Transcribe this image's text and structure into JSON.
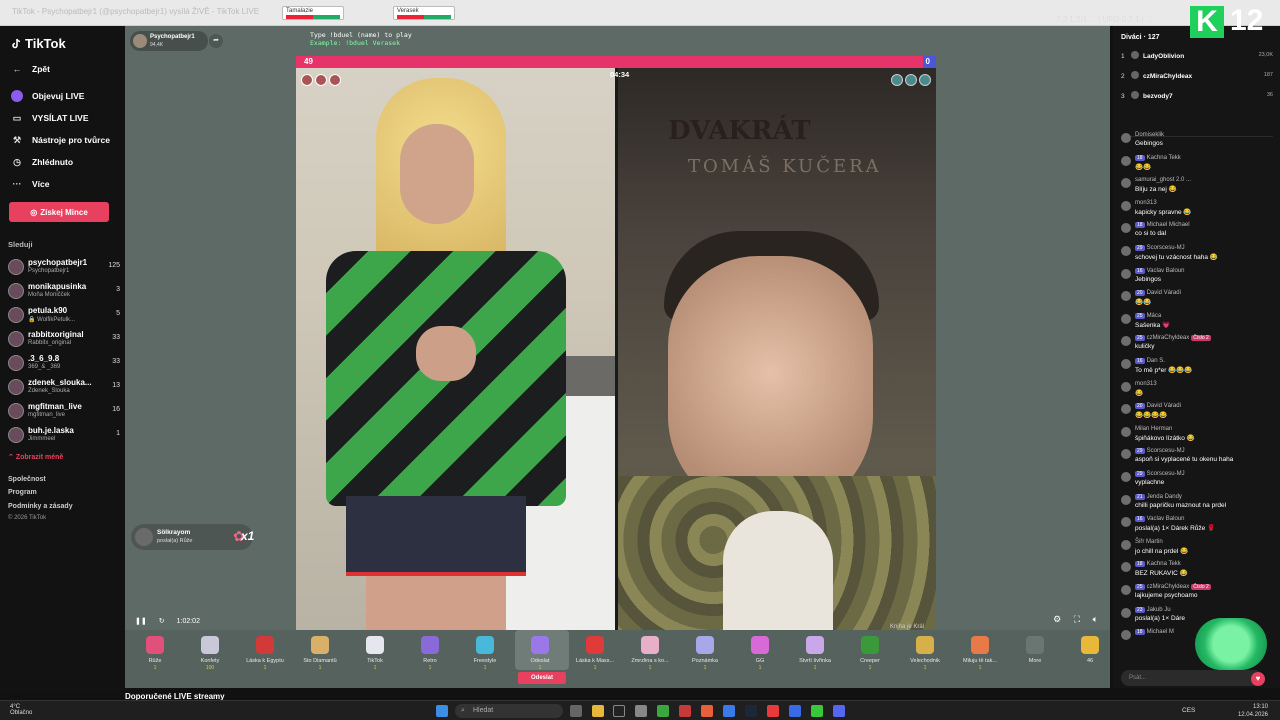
{
  "browser": {
    "tab_text": "TikTok - Psychopatbejr1 (@psychopatbejr1) vysílá ŽIVĚ - TikTok LIVE",
    "mini_tab_left": "Tamalazie",
    "mini_tab_right": "Verasek"
  },
  "sidebar": {
    "logo": "TikTok",
    "nav": [
      {
        "label": "Zpět",
        "icon": "back-arrow-icon"
      },
      {
        "label": "Objevuj LIVE",
        "icon": "live-icon"
      },
      {
        "label": "VYSÍLAT LIVE",
        "icon": "video-icon"
      },
      {
        "label": "Nástroje pro tvůrce",
        "icon": "tools-icon"
      },
      {
        "label": "Zhlédnuto",
        "icon": "history-icon"
      },
      {
        "label": "Více",
        "icon": "more-icon"
      }
    ],
    "coins_button": "Získej Mince",
    "following_title": "Sleduji",
    "following": [
      {
        "name": "psychopatbejr1",
        "sub": "Psychopatbejr1",
        "count": "125"
      },
      {
        "name": "monikapusinka",
        "sub": "Moňa Moničček",
        "count": "3"
      },
      {
        "name": "petula.k90",
        "sub": "🔒 WolfikPetulk...",
        "count": "5"
      },
      {
        "name": "rabbitxoriginal",
        "sub": "Rabbitx_original",
        "count": "33"
      },
      {
        "name": ".3_6_9.8",
        "sub": "369_& _369",
        "count": "33"
      },
      {
        "name": "zdenek_slouka...",
        "sub": "Zdenek_Slouka",
        "count": "13"
      },
      {
        "name": "mgfitman_live",
        "sub": "mgfitman_live",
        "count": "16"
      },
      {
        "name": "buh.je.laska",
        "sub": "Jimmmeel",
        "count": "1"
      }
    ],
    "show_less": "Zobrazit méně",
    "footer_links": [
      "Společnost",
      "Program",
      "Podmínky a zásady"
    ],
    "copyright": "© 2026 TikTok"
  },
  "stream": {
    "host_name": "Psychopatbejr1",
    "host_likes": "94,4K",
    "overlay_type": "Type !bduel (name) to play",
    "overlay_example": "Example: !bduel Verasek",
    "left_score": "49",
    "right_score": "0",
    "left_ratio": 0.98,
    "timer": "04:34",
    "wall_logo": "DVAKRÁT",
    "wall_text": "TOMÁŠ KUČERA",
    "right_caption": "Kniha je Král",
    "gift_popup": {
      "name": "Sölkrayom",
      "action": "poslal(a) Růže",
      "multiplier": "x1"
    },
    "playback_time": "1:02:02",
    "recommended": "Doporučené LIVE streamy"
  },
  "gifts": [
    {
      "name": "Růže",
      "price": "1",
      "color": "#e0507a"
    },
    {
      "name": "Konfety",
      "price": "100",
      "color": "#c8c8d8"
    },
    {
      "name": "Láska k Egyptu",
      "price": "1",
      "color": "#d23a3a"
    },
    {
      "name": "Sto Diamantů",
      "price": "1",
      "color": "#d8b06a"
    },
    {
      "name": "TikTok",
      "price": "1",
      "color": "#e6e6ee"
    },
    {
      "name": "Retro",
      "price": "1",
      "color": "#8a6ad8"
    },
    {
      "name": "Freestyle",
      "price": "1",
      "color": "#4ab8d8"
    },
    {
      "name": "Odeslat",
      "price": "1",
      "color": "#9a78e8"
    },
    {
      "name": "Láska k Mass...",
      "price": "1",
      "color": "#e03a3a"
    },
    {
      "name": "Zmrzlina s ko...",
      "price": "1",
      "color": "#e8b0c8"
    },
    {
      "name": "Poznámka",
      "price": "1",
      "color": "#a8a8e8"
    },
    {
      "name": "GG",
      "price": "1",
      "color": "#d86ad8"
    },
    {
      "name": "Stvrtí švřinka",
      "price": "1",
      "color": "#c8a8e8"
    },
    {
      "name": "Creeper",
      "price": "1",
      "color": "#3a9a3a"
    },
    {
      "name": "Velechodnik",
      "price": "1",
      "color": "#d8b04a"
    },
    {
      "name": "Miluju tě tak...",
      "price": "1",
      "color": "#e87a4a"
    },
    {
      "name": "More",
      "price": "",
      "color": "#6a7672"
    },
    {
      "name": "46",
      "price": "",
      "color": "#e8b83a"
    }
  ],
  "send_label": "Odeslat",
  "chat": {
    "viewers_title": "Diváci · 127",
    "top_viewers": [
      {
        "rank": "1",
        "name": "LadyOblivion",
        "score": "23,0K"
      },
      {
        "rank": "2",
        "name": "czMiraChyldeax",
        "score": "187"
      },
      {
        "rank": "3",
        "name": "bezvody7",
        "score": "36"
      }
    ],
    "messages": [
      {
        "user": "Domiseklik",
        "badge": "",
        "text": "Gebingos",
        "extra": ""
      },
      {
        "user": "Kachna Tekk",
        "badge": "18",
        "text": "😂😂",
        "extra": ""
      },
      {
        "user": "samurai_ghost 2.0 ...",
        "badge": "",
        "text": "Blíju za nej 😂",
        "extra": ""
      },
      {
        "user": "mon313",
        "badge": "",
        "text": "kapicky spravne 😂",
        "extra": ""
      },
      {
        "user": "Michael Michael",
        "badge": "18",
        "text": "co si to dal",
        "extra": ""
      },
      {
        "user": "Scorscesu-MJ",
        "badge": "29",
        "text": "schovej tu vzácnost haha 😂",
        "extra": ""
      },
      {
        "user": "Vaclav Baloun",
        "badge": "16",
        "text": "Jebingos",
        "extra": ""
      },
      {
        "user": "David Váradi",
        "badge": "20",
        "text": "😂😂",
        "extra": ""
      },
      {
        "user": "Máca",
        "badge": "25",
        "text": "Sašenka 💗",
        "extra": ""
      },
      {
        "user": "czMiraChyldeax",
        "badge": "25",
        "text": "kuličky",
        "extra": "Číslo 2"
      },
      {
        "user": "Dan S.",
        "badge": "16",
        "text": "To mě p*er 😂😂😂",
        "extra": ""
      },
      {
        "user": "mon313",
        "badge": "",
        "text": "😂",
        "extra": ""
      },
      {
        "user": "David Váradi",
        "badge": "20",
        "text": "😂😂😂😂",
        "extra": ""
      },
      {
        "user": "Milan Herman",
        "badge": "",
        "text": "špiňákovo lízátko 😂",
        "extra": ""
      },
      {
        "user": "Scorscesu-MJ",
        "badge": "29",
        "text": "aspoň si vyplacené tu okenu haha",
        "extra": ""
      },
      {
        "user": "Scorscesu-MJ",
        "badge": "29",
        "text": "vyplachne",
        "extra": ""
      },
      {
        "user": "Jenda Dandy",
        "badge": "21",
        "text": "chilli papričku maznout na prdel",
        "extra": ""
      },
      {
        "user": "Vaclav Baloun",
        "badge": "16",
        "text": "poslal(a) 1× Dárek Růže 🌹",
        "extra": ""
      },
      {
        "user": "Šiřr Martin",
        "badge": "",
        "text": "jo chill na prdel 😂",
        "extra": ""
      },
      {
        "user": "Kachna Tekk",
        "badge": "18",
        "text": "BEZ RUKAVIC 😂",
        "extra": ""
      },
      {
        "user": "czMiraChyldeax",
        "badge": "25",
        "text": "lajkujeme psychoamo",
        "extra": "Číslo 2"
      },
      {
        "user": "Jakub Ju",
        "badge": "23",
        "text": "poslal(a) 1× Dáre",
        "extra": ""
      },
      {
        "user": "Michael M",
        "badge": "18",
        "text": "",
        "extra": ""
      }
    ],
    "input_placeholder": "Psát..."
  },
  "overlay_counter": {
    "letter": "K",
    "number": "12"
  },
  "overlay_stats": "7:3 1:2/1 ... | UFO 0:2:1 | ...",
  "taskbar": {
    "weather_temp": "4°C",
    "weather_desc": "Oblačno",
    "search": "Hledat",
    "lang": "CES",
    "time": "13:10",
    "date": "12.04.2026"
  }
}
